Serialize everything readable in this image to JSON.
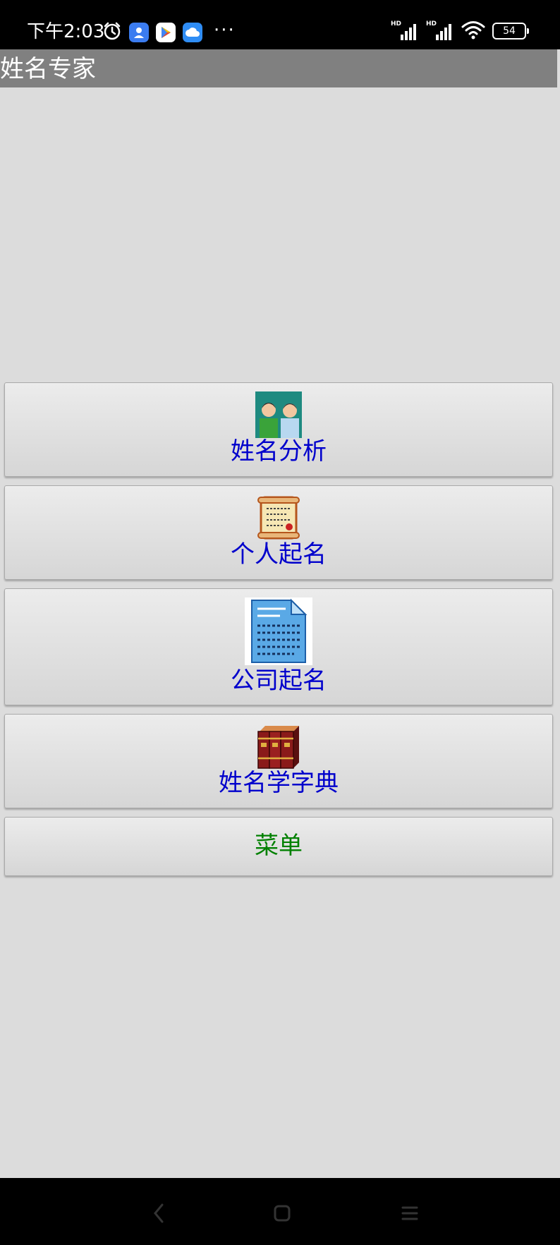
{
  "status_bar": {
    "time": "下午2:03",
    "more": "···",
    "battery": "54"
  },
  "title_bar": {
    "title": "姓名专家"
  },
  "menu": {
    "items": [
      {
        "label": "姓名分析",
        "icon": "people-icon"
      },
      {
        "label": "个人起名",
        "icon": "scroll-icon"
      },
      {
        "label": "公司起名",
        "icon": "document-icon"
      },
      {
        "label": "姓名学字典",
        "icon": "books-icon"
      },
      {
        "label": "菜单"
      }
    ]
  },
  "colors": {
    "title_bar_bg": "#808080",
    "screen_bg": "#dcdcdc",
    "label_blue": "#0000cc",
    "label_green": "#008000"
  }
}
